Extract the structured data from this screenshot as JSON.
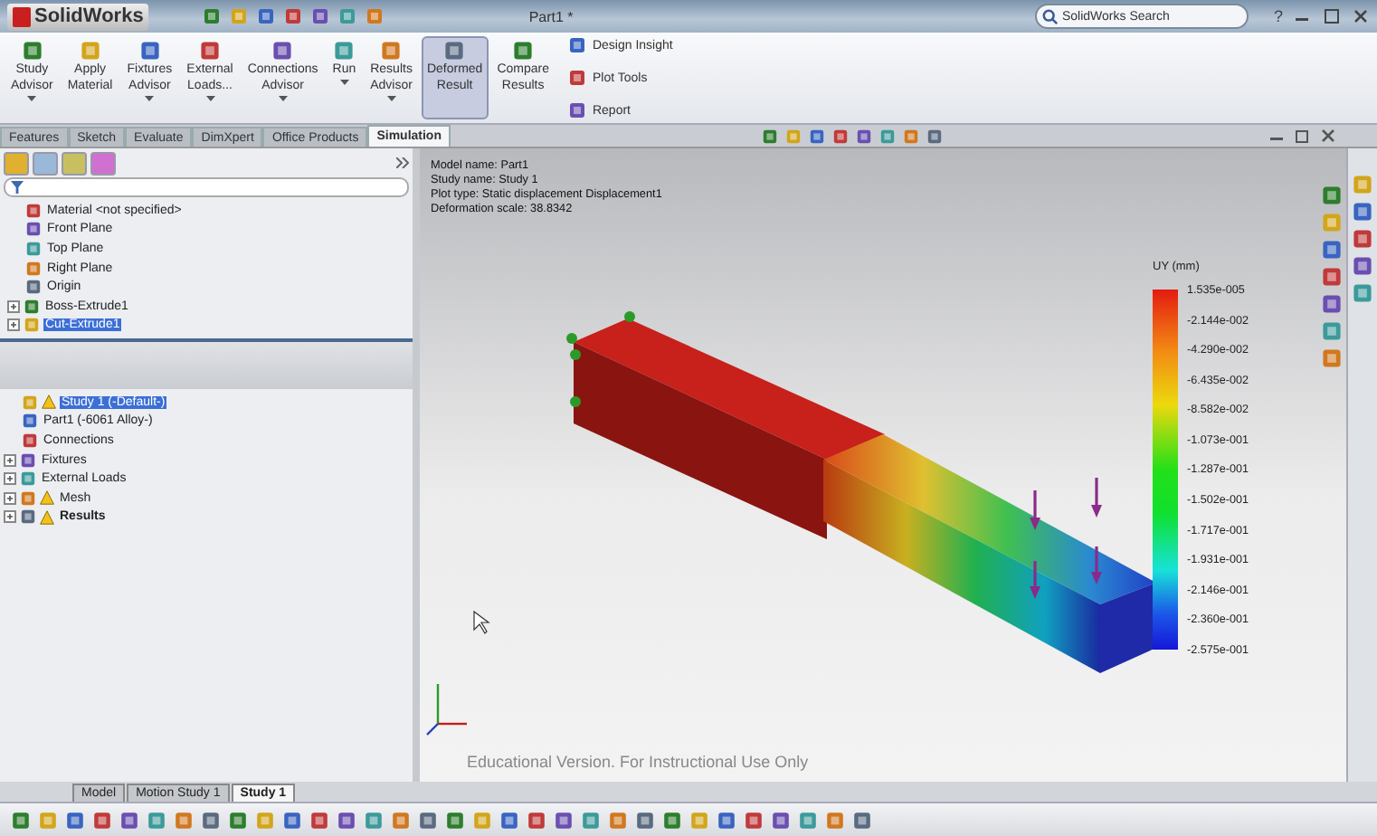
{
  "title_bar": {
    "app_name": "SolidWorks",
    "document": "Part1 *",
    "search_placeholder": "SolidWorks Search",
    "help": "?"
  },
  "ribbon": {
    "buttons": [
      {
        "lines": [
          "Study",
          "Advisor"
        ],
        "has_menu": true,
        "selected": false
      },
      {
        "lines": [
          "Apply",
          "Material"
        ],
        "has_menu": false,
        "selected": false
      },
      {
        "lines": [
          "Fixtures",
          "Advisor"
        ],
        "has_menu": true,
        "selected": false
      },
      {
        "lines": [
          "External",
          "Loads..."
        ],
        "has_menu": true,
        "selected": false
      },
      {
        "lines": [
          "Connections",
          "Advisor"
        ],
        "has_menu": true,
        "selected": false
      },
      {
        "lines": [
          "Run"
        ],
        "has_menu": true,
        "selected": false
      },
      {
        "lines": [
          "Results",
          "Advisor"
        ],
        "has_menu": true,
        "selected": false
      },
      {
        "lines": [
          "Deformed",
          "Result"
        ],
        "has_menu": false,
        "selected": true
      },
      {
        "lines": [
          "Compare",
          "Results"
        ],
        "has_menu": false,
        "selected": false
      }
    ],
    "side_items": [
      "Design Insight",
      "Plot Tools",
      "Report"
    ]
  },
  "tabs": [
    {
      "label": "Features",
      "selected": false
    },
    {
      "label": "Sketch",
      "selected": false
    },
    {
      "label": "Evaluate",
      "selected": false
    },
    {
      "label": "DimXpert",
      "selected": false
    },
    {
      "label": "Office Products",
      "selected": false
    },
    {
      "label": "Simulation",
      "selected": true
    }
  ],
  "feature_tree": [
    {
      "label": "Material <not specified>",
      "expandable": false,
      "selected": false
    },
    {
      "label": "Front Plane",
      "expandable": false,
      "selected": false
    },
    {
      "label": "Top Plane",
      "expandable": false,
      "selected": false
    },
    {
      "label": "Right Plane",
      "expandable": false,
      "selected": false
    },
    {
      "label": "Origin",
      "expandable": false,
      "selected": false
    },
    {
      "label": "Boss-Extrude1",
      "expandable": true,
      "selected": false
    },
    {
      "label": "Cut-Extrude1",
      "expandable": true,
      "selected": true
    }
  ],
  "study_tree": [
    {
      "label": "Study 1 (-Default-)",
      "expandable": false,
      "warning": true,
      "bold": false,
      "selected": true
    },
    {
      "label": "Part1 (-6061 Alloy-)",
      "expandable": false,
      "warning": false,
      "bold": false,
      "selected": false
    },
    {
      "label": "Connections",
      "expandable": false,
      "warning": false,
      "bold": false,
      "selected": false
    },
    {
      "label": "Fixtures",
      "expandable": true,
      "warning": false,
      "bold": false,
      "selected": false
    },
    {
      "label": "External Loads",
      "expandable": true,
      "warning": false,
      "bold": false,
      "selected": false
    },
    {
      "label": "Mesh",
      "expandable": true,
      "warning": true,
      "bold": false,
      "selected": false
    },
    {
      "label": "Results",
      "expandable": true,
      "warning": true,
      "bold": true,
      "selected": false
    }
  ],
  "plot_info": [
    "Model name: Part1",
    "Study name: Study 1",
    "Plot type: Static displacement Displacement1",
    "Deformation scale: 38.8342"
  ],
  "legend": {
    "title": "UY (mm)",
    "labels": [
      "1.535e-005",
      "-2.144e-002",
      "-4.290e-002",
      "-6.435e-002",
      "-8.582e-002",
      "-1.073e-001",
      "-1.287e-001",
      "-1.502e-001",
      "-1.717e-001",
      "-1.931e-001",
      "-2.146e-001",
      "-2.360e-001",
      "-2.575e-001"
    ]
  },
  "notice": "Educational Version. For Instructional Use Only",
  "bottom_tabs": [
    {
      "label": "Model",
      "selected": false
    },
    {
      "label": "Motion Study 1",
      "selected": false
    },
    {
      "label": "Study 1",
      "selected": true
    }
  ]
}
